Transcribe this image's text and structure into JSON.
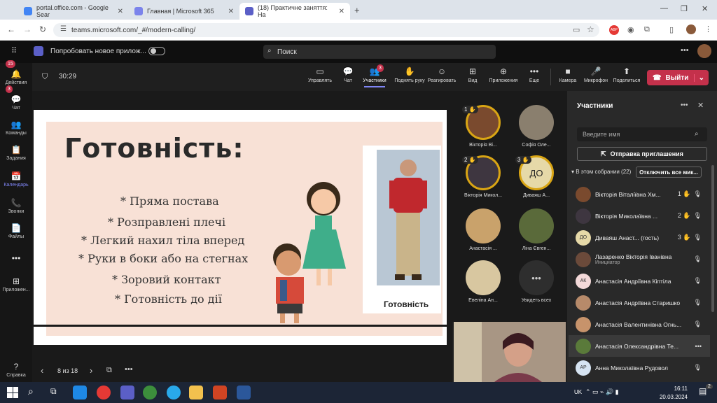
{
  "browser": {
    "tabs": [
      {
        "title": "portal.office.com - Google Sear",
        "color": "#4285f4"
      },
      {
        "title": "Главная | Microsoft 365",
        "color": "#7b83eb"
      },
      {
        "title": "(18) Практичне заняття: На",
        "color": "#5b5fc7"
      }
    ],
    "url": "teams.microsoft.com/_#/modern-calling/"
  },
  "teams": {
    "promo": "Попробовать новое прилож...",
    "search_placeholder": "Поиск"
  },
  "rail": [
    {
      "label": "Действия",
      "icon": "bell-icon",
      "glyph": "🔔",
      "badge": "15"
    },
    {
      "label": "Чат",
      "icon": "chat-icon",
      "glyph": "💬",
      "badge": "3"
    },
    {
      "label": "Команды",
      "icon": "teams-icon",
      "glyph": "👥",
      "badge": ""
    },
    {
      "label": "Задания",
      "icon": "assignments-icon",
      "glyph": "📋",
      "badge": ""
    },
    {
      "label": "Календарь",
      "icon": "calendar-icon",
      "glyph": "📅",
      "badge": ""
    },
    {
      "label": "Звонки",
      "icon": "phone-icon",
      "glyph": "📞",
      "badge": ""
    },
    {
      "label": "Файлы",
      "icon": "files-icon",
      "glyph": "📄",
      "badge": ""
    },
    {
      "label": "",
      "icon": "more-icon",
      "glyph": "•••",
      "badge": ""
    },
    {
      "label": "Приложен...",
      "icon": "apps-icon",
      "glyph": "⊞",
      "badge": ""
    },
    {
      "label": "Справка",
      "icon": "help-icon",
      "glyph": "?",
      "badge": ""
    }
  ],
  "meeting": {
    "timer": "30:29",
    "tools": [
      {
        "label": "Управлять",
        "icon": "share-screen-icon",
        "glyph": "▭"
      },
      {
        "label": "Чат",
        "icon": "chat-icon",
        "glyph": "💬"
      },
      {
        "label": "Участники",
        "icon": "people-icon",
        "glyph": "👥",
        "badge": "3"
      },
      {
        "label": "Поднять руку",
        "icon": "raise-hand-icon",
        "glyph": "✋"
      },
      {
        "label": "Реагировать",
        "icon": "react-icon",
        "glyph": "☺"
      },
      {
        "label": "Вид",
        "icon": "view-icon",
        "glyph": "⊞"
      },
      {
        "label": "Приложения",
        "icon": "add-app-icon",
        "glyph": "⊕"
      },
      {
        "label": "Еще",
        "icon": "more-icon",
        "glyph": "•••"
      },
      {
        "label": "Камера",
        "icon": "camera-icon",
        "glyph": "■"
      },
      {
        "label": "Микрофон",
        "icon": "mic-icon",
        "glyph": "🎤"
      },
      {
        "label": "Поделиться",
        "icon": "share-icon",
        "glyph": "⬆"
      }
    ],
    "leave_label": "Выйти"
  },
  "slide": {
    "title": "Готовність:",
    "lines": [
      "* Пряма постава",
      "* Розправлені плечі",
      "* Легкий нахил тіла вперед",
      "* Руки в боки або на стегнах",
      "* Зоровий контакт",
      "* Готовність до дії"
    ],
    "caption": "Готовність",
    "page": "8 из 18"
  },
  "grid": [
    {
      "name": "Вікторія Ві...",
      "hand": "1",
      "ring": true,
      "color": "#7a4a2e"
    },
    {
      "name": "Софія Оле...",
      "hand": "",
      "ring": false,
      "color": "#8a7f6e"
    },
    {
      "name": "Вікторія Микол...",
      "hand": "2",
      "ring": true,
      "color": "#3e3640"
    },
    {
      "name": "Диваяш А...",
      "hand": "3",
      "ring": true,
      "color": "#e6d9a8",
      "initials": "ДО"
    },
    {
      "name": "Анастасія ...",
      "hand": "",
      "ring": false,
      "color": "#c9a26b"
    },
    {
      "name": "Ліна Євген...",
      "hand": "",
      "ring": false,
      "color": "#5a6a3a"
    },
    {
      "name": "Евеліна Ан...",
      "hand": "",
      "ring": false,
      "color": "#d8c7a0"
    },
    {
      "name": "Увидеть всех",
      "hand": "",
      "ring": false,
      "color": "#2e2e2e",
      "initials": "•••"
    }
  ],
  "panel": {
    "title": "Участники",
    "search_placeholder": "Введите имя",
    "invite_label": "Отправка приглашения",
    "section_label": "В этом собрании (22)",
    "mute_all_label": "Отключить все мик...",
    "people": [
      {
        "name": "Вікторія Віталіївна Хм...",
        "hand": "1",
        "mic": "🎙",
        "avatar_color": "#7a4a2e"
      },
      {
        "name": "Вікторія Миколаївна ...",
        "hand": "2",
        "mic": "🎙",
        "avatar_color": "#3e3640"
      },
      {
        "name": "Диваяш Анаст... (гость)",
        "hand": "3",
        "mic": "🎙",
        "avatar_color": "#e6d9a8",
        "initials": "ДО"
      },
      {
        "name": "Лазаренко Вікторія Іванівна",
        "sub": "Инициатор",
        "hand": "",
        "mic": "🎙",
        "avatar_color": "#6b4a3a"
      },
      {
        "name": "Анастасія Андріївна Кіптіла",
        "hand": "",
        "mic": "🎙",
        "avatar_color": "#f4d9d9",
        "initials": "АК"
      },
      {
        "name": "Анастасія Андріївна Старишко",
        "hand": "",
        "mic": "🎙",
        "avatar_color": "#b78a6a"
      },
      {
        "name": "Анастасія Валентинівна Огнь...",
        "hand": "",
        "mic": "🎙",
        "avatar_color": "#c7936b"
      },
      {
        "name": "Анастасія Олександрівна Те...",
        "hand": "",
        "mic": "•••",
        "avatar_color": "#5a7a3a"
      },
      {
        "name": "Анна Миколаївна Рудовол",
        "hand": "",
        "mic": "🎙",
        "avatar_color": "#d6e4f2",
        "initials": "АР"
      }
    ]
  },
  "taskbar": {
    "lang": "UK",
    "time": "16:11",
    "date": "20.03.2024",
    "notif": "2"
  }
}
